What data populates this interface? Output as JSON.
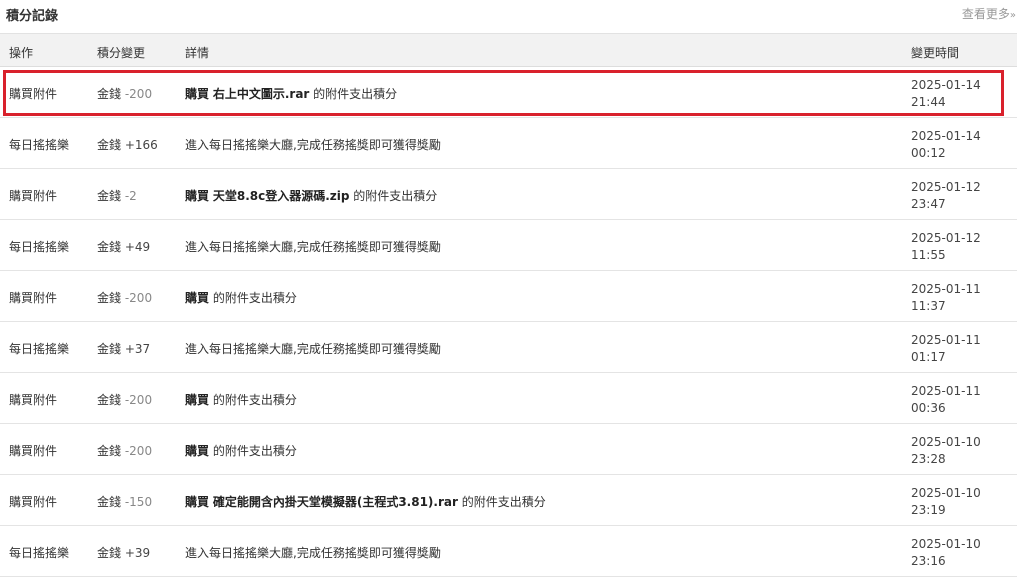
{
  "header": {
    "title": "積分記錄",
    "more_label": "查看更多",
    "more_arrow": "»"
  },
  "columns": {
    "op": "操作",
    "points": "積分變更",
    "detail": "詳情",
    "time": "變更時間"
  },
  "rows": [
    {
      "op": "購買附件",
      "currency": "金錢",
      "delta": "-200",
      "positive": false,
      "detail_prefix": "購買",
      "item": "右上中文圖示.rar",
      "detail_suffix": "的附件支出積分",
      "date": "2025-01-14",
      "clock": "21:44"
    },
    {
      "op": "每日搖搖樂",
      "currency": "金錢",
      "delta": "+166",
      "positive": true,
      "detail_prefix": "",
      "item": "",
      "detail_suffix": "進入每日搖搖樂大廳,完成任務搖獎即可獲得獎勵",
      "date": "2025-01-14",
      "clock": "00:12"
    },
    {
      "op": "購買附件",
      "currency": "金錢",
      "delta": "-2",
      "positive": false,
      "detail_prefix": "購買",
      "item": "天堂8.8c登入器源碼.zip",
      "detail_suffix": "的附件支出積分",
      "date": "2025-01-12",
      "clock": "23:47"
    },
    {
      "op": "每日搖搖樂",
      "currency": "金錢",
      "delta": "+49",
      "positive": true,
      "detail_prefix": "",
      "item": "",
      "detail_suffix": "進入每日搖搖樂大廳,完成任務搖獎即可獲得獎勵",
      "date": "2025-01-12",
      "clock": "11:55"
    },
    {
      "op": "購買附件",
      "currency": "金錢",
      "delta": "-200",
      "positive": false,
      "detail_prefix": "購買",
      "item": "",
      "detail_suffix": "的附件支出積分",
      "date": "2025-01-11",
      "clock": "11:37"
    },
    {
      "op": "每日搖搖樂",
      "currency": "金錢",
      "delta": "+37",
      "positive": true,
      "detail_prefix": "",
      "item": "",
      "detail_suffix": "進入每日搖搖樂大廳,完成任務搖獎即可獲得獎勵",
      "date": "2025-01-11",
      "clock": "01:17"
    },
    {
      "op": "購買附件",
      "currency": "金錢",
      "delta": "-200",
      "positive": false,
      "detail_prefix": "購買",
      "item": "",
      "detail_suffix": "的附件支出積分",
      "date": "2025-01-11",
      "clock": "00:36"
    },
    {
      "op": "購買附件",
      "currency": "金錢",
      "delta": "-200",
      "positive": false,
      "detail_prefix": "購買",
      "item": "",
      "detail_suffix": "的附件支出積分",
      "date": "2025-01-10",
      "clock": "23:28"
    },
    {
      "op": "購買附件",
      "currency": "金錢",
      "delta": "-150",
      "positive": false,
      "detail_prefix": "購買",
      "item": "確定能開含內掛天堂模擬器(主程式3.81).rar",
      "detail_suffix": "的附件支出積分",
      "date": "2025-01-10",
      "clock": "23:19"
    },
    {
      "op": "每日搖搖樂",
      "currency": "金錢",
      "delta": "+39",
      "positive": true,
      "detail_prefix": "",
      "item": "",
      "detail_suffix": "進入每日搖搖樂大廳,完成任務搖獎即可獲得獎勵",
      "date": "2025-01-10",
      "clock": "23:16"
    }
  ],
  "highlight": {
    "row_index": 0,
    "color": "#d9212c"
  }
}
